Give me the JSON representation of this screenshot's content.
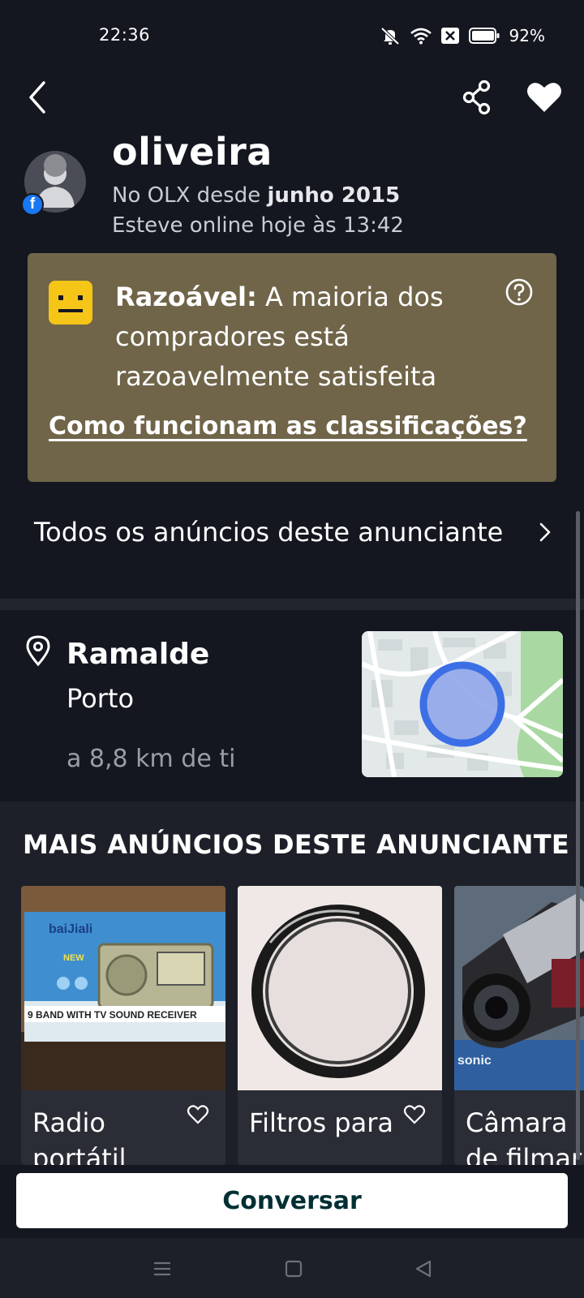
{
  "status_bar": {
    "time": "22:36",
    "battery": "92%",
    "icons": [
      "mute-icon",
      "wifi-icon",
      "sim-off-icon",
      "battery-icon"
    ]
  },
  "header": {
    "back_icon": "back-arrow-icon",
    "share_icon": "share-icon",
    "favorite_icon": "heart-filled-icon"
  },
  "seller": {
    "name": "oliveira",
    "member_since_prefix": "No OLX desde",
    "member_since_date": "junho 2015",
    "online_status": "Esteve online hoje às 13:42",
    "social_badge": "f"
  },
  "rating": {
    "label": "Razoável:",
    "description": "A maioria dos compradores está razoavelmente satisfeita",
    "help_link": "Como funcionam as classificações?",
    "card_color": "#706549",
    "face_color": "#f5c518"
  },
  "all_ads_link": "Todos os anúncios deste anunciante",
  "location": {
    "area": "Ramalde",
    "city": "Porto",
    "distance": "a 8,8 km de ti"
  },
  "more_ads": {
    "title": "MAIS ANÚNCIOS DESTE ANUNCIANTE",
    "items": [
      {
        "title": "Radio portátil",
        "image_text_brand": "baiJiali",
        "image_text_band": "9 BAND WITH TV SOUND RECEIVER",
        "image_text_new": "NEW"
      },
      {
        "title": "Filtros para"
      },
      {
        "title": "Câmara de filmar",
        "image_text_brand": "sonic"
      }
    ]
  },
  "cta": {
    "label": "Conversar"
  },
  "colors": {
    "background": "#14171f",
    "primary_text": "#ffffff",
    "cta_text": "#002f34"
  }
}
